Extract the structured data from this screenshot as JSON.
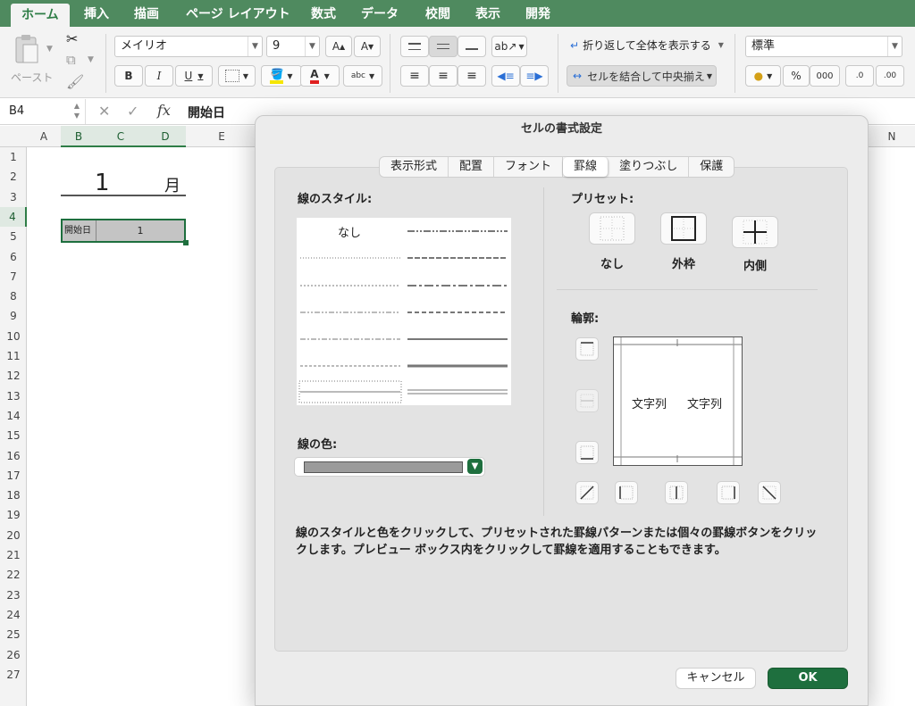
{
  "ribbon_tabs": [
    "ホーム",
    "挿入",
    "描画",
    "ページ レイアウト",
    "数式",
    "データ",
    "校閲",
    "表示",
    "開発"
  ],
  "ribbon": {
    "paste_label": "ペースト",
    "font_name": "メイリオ",
    "font_size": "9",
    "wrap_text": "折り返して全体を表示する",
    "merge_center": "セルを結合して中央揃え",
    "number_format": "標準",
    "bold": "B",
    "italic": "I",
    "underline": "U",
    "comma": "000",
    "percent": "%",
    "abc": "abc",
    "font_color_letter": "A",
    "dec_increase": ".0",
    "dec_decrease": ".00"
  },
  "formula_bar": {
    "cell_ref": "B4",
    "fx": "fx",
    "content": "開始日"
  },
  "columns": [
    "A",
    "B",
    "C",
    "D",
    "E",
    "N"
  ],
  "rows": [
    "1",
    "2",
    "3",
    "4",
    "5",
    "6",
    "7",
    "8",
    "9",
    "10",
    "11",
    "12",
    "13",
    "14",
    "15",
    "16",
    "17",
    "18",
    "19",
    "20",
    "21",
    "22",
    "23",
    "24",
    "25",
    "26",
    "27"
  ],
  "cells": {
    "month_number": "1",
    "month_label": "月",
    "start_label": "開始日",
    "start_value": "1"
  },
  "dialog": {
    "title": "セルの書式設定",
    "tabs": [
      "表示形式",
      "配置",
      "フォント",
      "罫線",
      "塗りつぶし",
      "保護"
    ],
    "active_tab": "罫線",
    "line_style_label": "線のスタイル:",
    "line_none": "なし",
    "line_color_label": "線の色:",
    "presets_label": "プリセット:",
    "presets": [
      "なし",
      "外枠",
      "内側"
    ],
    "border_label": "輪郭:",
    "preview_text_left": "文字列",
    "preview_text_right": "文字列",
    "instructions": "線のスタイルと色をクリックして、プリセットされた罫線パターンまたは個々の罫線ボタンをクリックします。プレビュー ボックス内をクリックして罫線を適用することもできます。",
    "cancel": "キャンセル",
    "ok": "OK"
  },
  "colors": {
    "ribbon_green": "#4f8a5f",
    "ok_green": "#1e6f3e",
    "line_color": "#9b9b9b"
  }
}
